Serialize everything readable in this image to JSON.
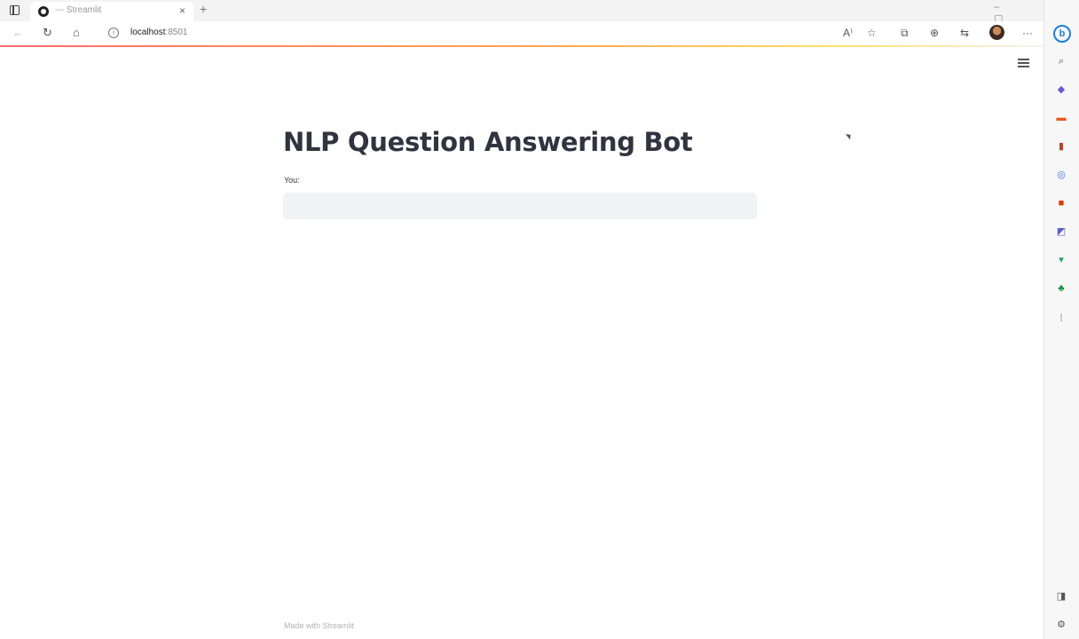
{
  "browser": {
    "tab_title": "--- Streamlit",
    "tab_close": "×",
    "new_tab": "+",
    "url_host": "localhost",
    "url_port": ":8501",
    "window_controls": "– ▢ ✕"
  },
  "app": {
    "title": "NLP Question Answering Bot",
    "input_label": "You:",
    "input_value": "",
    "footer": "Made with Streamlit"
  },
  "icons": {
    "toolbar": [
      "back-icon",
      "refresh-icon",
      "home-icon",
      "info-icon"
    ],
    "toolbar_right": [
      "read-aloud-icon",
      "favorites-icon",
      "extensions-icon",
      "collections-icon",
      "profile-switch-icon",
      "profile-avatar",
      "more-icon"
    ],
    "sidebar": [
      "bing-icon",
      "search-icon",
      "tag-icon",
      "shopping-icon",
      "tools-icon",
      "games-icon",
      "office-icon",
      "outlook-icon",
      "drop-icon",
      "tree-icon",
      "more-tools-icon",
      "sidebar-toggle-icon",
      "settings-icon"
    ]
  },
  "colors": {
    "title": "#31333f",
    "input_bg": "#f0f2f6",
    "accent": "#ff4b4b"
  }
}
